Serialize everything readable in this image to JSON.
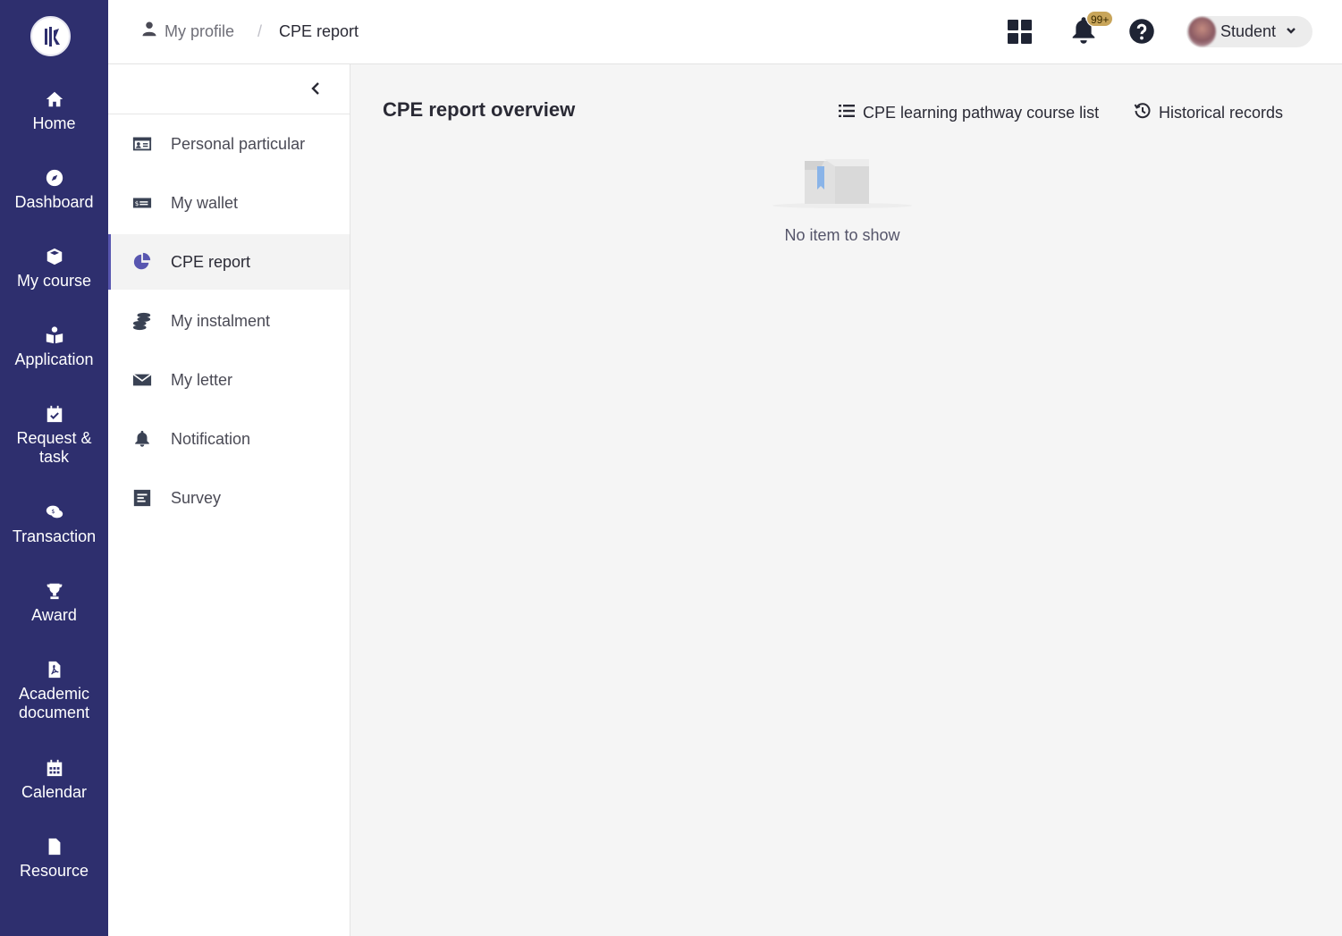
{
  "rail": {
    "items": [
      {
        "label": "Home",
        "icon": "home-icon"
      },
      {
        "label": "Dashboard",
        "icon": "compass-icon"
      },
      {
        "label": "My course",
        "icon": "cube-icon"
      },
      {
        "label": "Application",
        "icon": "reader-icon"
      },
      {
        "label": "Request & task",
        "icon": "calendar-check-icon"
      },
      {
        "label": "Transaction",
        "icon": "chat-dollar-icon"
      },
      {
        "label": "Award",
        "icon": "trophy-icon"
      },
      {
        "label": "Academic document",
        "icon": "file-pdf-icon"
      },
      {
        "label": "Calendar",
        "icon": "calendar-icon"
      },
      {
        "label": "Resource",
        "icon": "file-icon"
      }
    ]
  },
  "header": {
    "breadcrumb": {
      "home": "My profile",
      "separator": "/",
      "current": "CPE report"
    },
    "notification_badge": "99+",
    "user_name": "Student"
  },
  "subnav": {
    "items": [
      {
        "label": "Personal particular",
        "icon": "id-card-icon",
        "active": false
      },
      {
        "label": "My wallet",
        "icon": "money-check-icon",
        "active": false
      },
      {
        "label": "CPE report",
        "icon": "chart-pie-icon",
        "active": true
      },
      {
        "label": "My instalment",
        "icon": "coins-icon",
        "active": false
      },
      {
        "label": "My letter",
        "icon": "envelope-icon",
        "active": false
      },
      {
        "label": "Notification",
        "icon": "bell-icon",
        "active": false
      },
      {
        "label": "Survey",
        "icon": "poll-icon",
        "active": false
      }
    ]
  },
  "main": {
    "title": "CPE report overview",
    "actions": {
      "course_list": "CPE learning pathway course list",
      "historical": "Historical records"
    },
    "empty_text": "No item to show"
  },
  "colors": {
    "rail_bg": "#2e2f6e",
    "accent": "#5856b0",
    "badge": "#c8a55a"
  }
}
